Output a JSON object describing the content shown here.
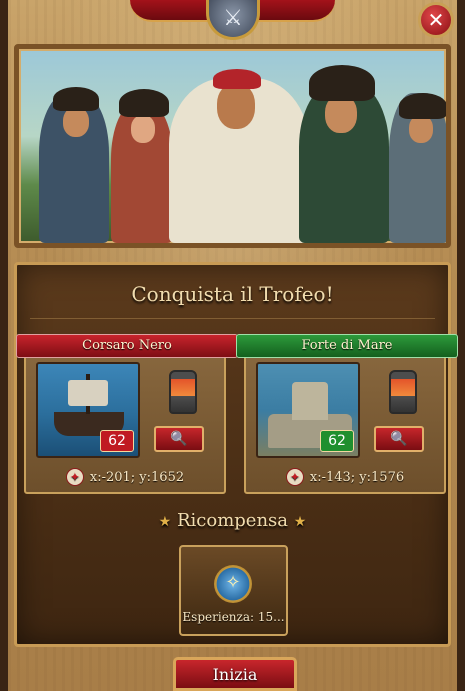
{
  "window": {
    "close_label": "✕",
    "emblem_label": "⚔"
  },
  "hero": {
    "image_name": "pirate-crew-artwork"
  },
  "mission": {
    "title": "Conquista il Trofeo!"
  },
  "targets": [
    {
      "name": "Corsaro Nero",
      "banner_color": "#b5161e",
      "level": "62",
      "coords": "x:-201; y:1652",
      "thumbnail": "pirate-ship"
    },
    {
      "name": "Forte di Mare",
      "banner_color": "#1f8a2c",
      "level": "62",
      "coords": "x:-143; y:1576",
      "thumbnail": "sea-fortress"
    }
  ],
  "reward": {
    "title": "Ricompensa",
    "label": "Esperienza: 15...",
    "icon": "compass-icon"
  },
  "actions": {
    "start_label": "Inizia",
    "search_icon": "🔍",
    "coords_icon": "✦"
  }
}
